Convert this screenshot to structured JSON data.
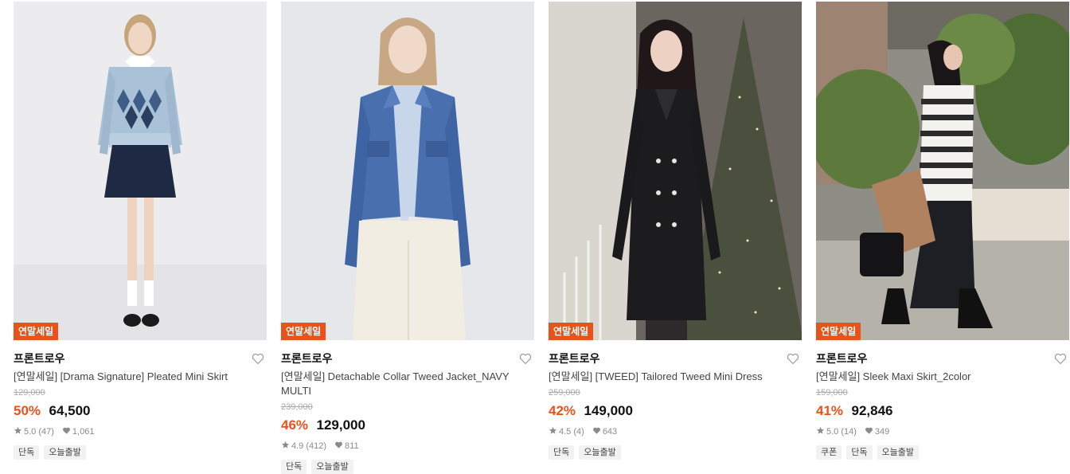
{
  "colors": {
    "accent": "#e8531c",
    "muted": "#8a8a8a",
    "tag_bg": "#f2f2f2"
  },
  "products": [
    {
      "badge": "연말세일",
      "brand": "프론트로우",
      "name": "[연말세일] [Drama Signature] Pleated Mini Skirt",
      "original_price": "129,000",
      "discount": "50%",
      "price": "64,500",
      "rating": "5.0",
      "reviews": "(47)",
      "likes": "1,061",
      "tags": [
        "단독",
        "오늘출발"
      ],
      "icons": [
        "heart-outline-icon",
        "star-icon",
        "heart-icon"
      ]
    },
    {
      "badge": "연말세일",
      "brand": "프론트로우",
      "name": "[연말세일] Detachable Collar Tweed Jacket_NAVY MULTI",
      "original_price": "239,000",
      "discount": "46%",
      "price": "129,000",
      "rating": "4.9",
      "reviews": "(412)",
      "likes": "811",
      "tags": [
        "단독",
        "오늘출발"
      ],
      "icons": [
        "heart-outline-icon",
        "star-icon",
        "heart-icon"
      ]
    },
    {
      "badge": "연말세일",
      "brand": "프론트로우",
      "name": "[연말세일] [TWEED] Tailored Tweed Mini Dress",
      "original_price": "259,000",
      "discount": "42%",
      "price": "149,000",
      "rating": "4.5",
      "reviews": "(4)",
      "likes": "643",
      "tags": [
        "단독",
        "오늘출발"
      ],
      "icons": [
        "heart-outline-icon",
        "star-icon",
        "heart-icon"
      ]
    },
    {
      "badge": "연말세일",
      "brand": "프론트로우",
      "name": "[연말세일] Sleek Maxi Skirt_2color",
      "original_price": "159,000",
      "discount": "41%",
      "price": "92,846",
      "rating": "5.0",
      "reviews": "(14)",
      "likes": "349",
      "tags": [
        "쿠폰",
        "단독",
        "오늘출발"
      ],
      "icons": [
        "heart-outline-icon",
        "star-icon",
        "heart-icon"
      ]
    }
  ]
}
